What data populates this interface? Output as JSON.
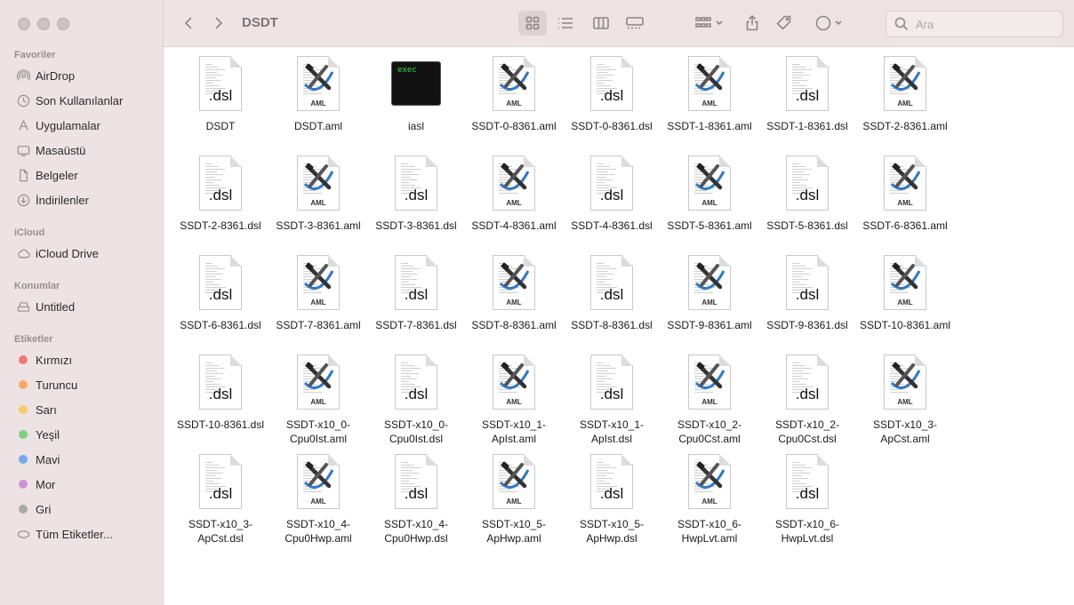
{
  "window": {
    "title": "DSDT"
  },
  "sidebar": {
    "sections": [
      {
        "title": "Favoriler",
        "items": [
          {
            "label": "AirDrop",
            "icon": "airdrop-icon"
          },
          {
            "label": "Son Kullanılanlar",
            "icon": "clock-icon"
          },
          {
            "label": "Uygulamalar",
            "icon": "apps-icon"
          },
          {
            "label": "Masaüstü",
            "icon": "desktop-icon"
          },
          {
            "label": "Belgeler",
            "icon": "document-icon"
          },
          {
            "label": "İndirilenler",
            "icon": "download-icon"
          }
        ]
      },
      {
        "title": "iCloud",
        "items": [
          {
            "label": "iCloud Drive",
            "icon": "cloud-icon"
          }
        ]
      },
      {
        "title": "Konumlar",
        "items": [
          {
            "label": "Untitled",
            "icon": "drive-icon"
          }
        ]
      },
      {
        "title": "Etiketler",
        "items": [
          {
            "label": "Kırmızı",
            "color": "#f0787a"
          },
          {
            "label": "Turuncu",
            "color": "#f5a86a"
          },
          {
            "label": "Sarı",
            "color": "#f2cf6b"
          },
          {
            "label": "Yeşil",
            "color": "#7fcf83"
          },
          {
            "label": "Mavi",
            "color": "#74a8ef"
          },
          {
            "label": "Mor",
            "color": "#c995d8"
          },
          {
            "label": "Gri",
            "color": "#a9a9a9"
          },
          {
            "label": "Tüm Etiketler...",
            "icon": "all-tags-icon"
          }
        ]
      }
    ]
  },
  "search": {
    "placeholder": "Ara"
  },
  "files": [
    {
      "name": "DSDT",
      "type": "dsl"
    },
    {
      "name": "DSDT.aml",
      "type": "aml"
    },
    {
      "name": "iasl",
      "type": "exec",
      "label": "exec"
    },
    {
      "name": "SSDT-0-8361.aml",
      "type": "aml"
    },
    {
      "name": "SSDT-0-8361.dsl",
      "type": "dsl"
    },
    {
      "name": "SSDT-1-8361.aml",
      "type": "aml"
    },
    {
      "name": "SSDT-1-8361.dsl",
      "type": "dsl"
    },
    {
      "name": "SSDT-2-8361.aml",
      "type": "aml"
    },
    {
      "name": "SSDT-2-8361.dsl",
      "type": "dsl"
    },
    {
      "name": "SSDT-3-8361.aml",
      "type": "aml"
    },
    {
      "name": "SSDT-3-8361.dsl",
      "type": "dsl"
    },
    {
      "name": "SSDT-4-8361.aml",
      "type": "aml"
    },
    {
      "name": "SSDT-4-8361.dsl",
      "type": "dsl"
    },
    {
      "name": "SSDT-5-8361.aml",
      "type": "aml"
    },
    {
      "name": "SSDT-5-8361.dsl",
      "type": "dsl"
    },
    {
      "name": "SSDT-6-8361.aml",
      "type": "aml"
    },
    {
      "name": "SSDT-6-8361.dsl",
      "type": "dsl"
    },
    {
      "name": "SSDT-7-8361.aml",
      "type": "aml"
    },
    {
      "name": "SSDT-7-8361.dsl",
      "type": "dsl"
    },
    {
      "name": "SSDT-8-8361.aml",
      "type": "aml"
    },
    {
      "name": "SSDT-8-8361.dsl",
      "type": "dsl"
    },
    {
      "name": "SSDT-9-8361.aml",
      "type": "aml"
    },
    {
      "name": "SSDT-9-8361.dsl",
      "type": "dsl"
    },
    {
      "name": "SSDT-10-8361.aml",
      "type": "aml"
    },
    {
      "name": "SSDT-10-8361.dsl",
      "type": "dsl"
    },
    {
      "name": "SSDT-x10_0-Cpu0Ist.aml",
      "type": "aml"
    },
    {
      "name": "SSDT-x10_0-Cpu0Ist.dsl",
      "type": "dsl"
    },
    {
      "name": "SSDT-x10_1-ApIst.aml",
      "type": "aml"
    },
    {
      "name": "SSDT-x10_1-ApIst.dsl",
      "type": "dsl"
    },
    {
      "name": "SSDT-x10_2-Cpu0Cst.aml",
      "type": "aml"
    },
    {
      "name": "SSDT-x10_2-Cpu0Cst.dsl",
      "type": "dsl"
    },
    {
      "name": "SSDT-x10_3-ApCst.aml",
      "type": "aml"
    },
    {
      "name": "SSDT-x10_3-ApCst.dsl",
      "type": "dsl"
    },
    {
      "name": "SSDT-x10_4-Cpu0Hwp.aml",
      "type": "aml"
    },
    {
      "name": "SSDT-x10_4-Cpu0Hwp.dsl",
      "type": "dsl"
    },
    {
      "name": "SSDT-x10_5-ApHwp.aml",
      "type": "aml"
    },
    {
      "name": "SSDT-x10_5-ApHwp.dsl",
      "type": "dsl"
    },
    {
      "name": "SSDT-x10_6-HwpLvt.aml",
      "type": "aml"
    },
    {
      "name": "SSDT-x10_6-HwpLvt.dsl",
      "type": "dsl"
    }
  ],
  "icon_text": {
    "dsl": ".dsl",
    "aml": "AML"
  }
}
